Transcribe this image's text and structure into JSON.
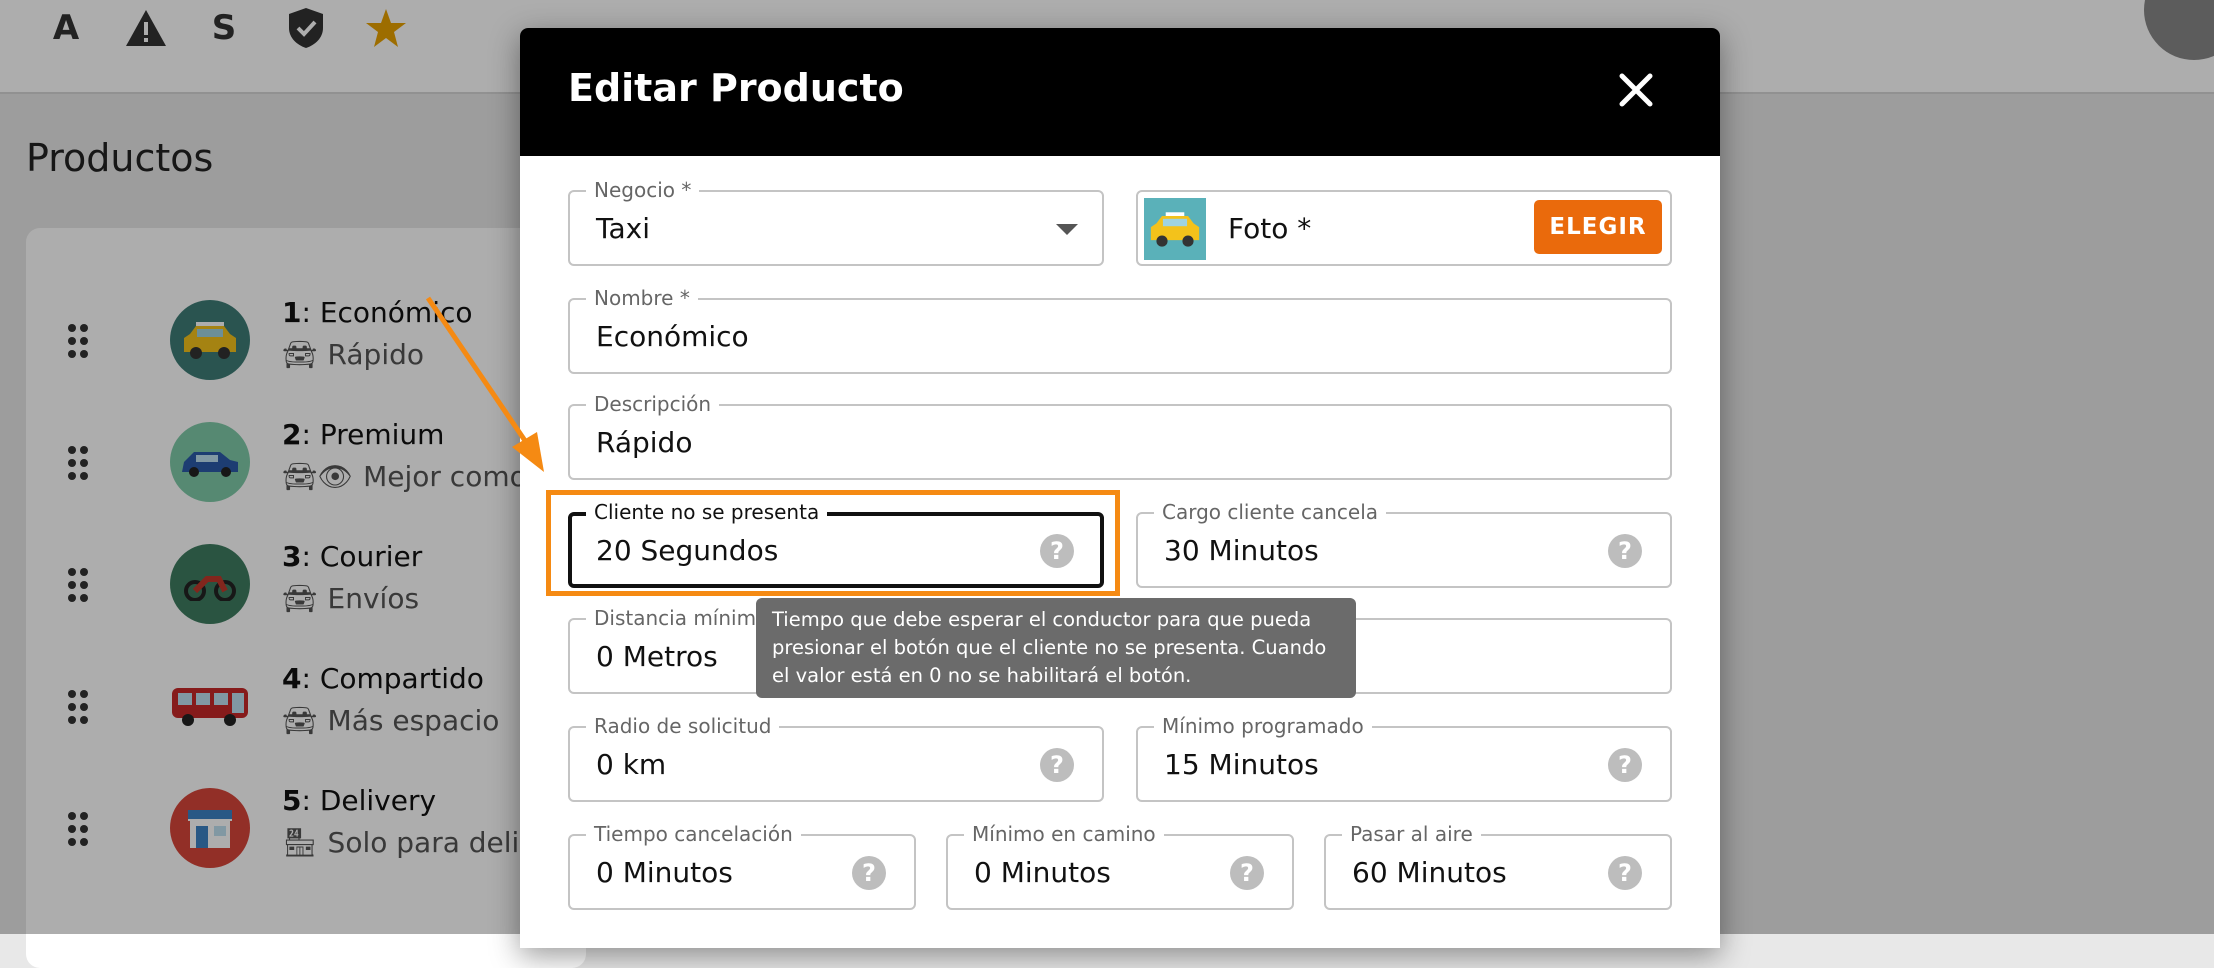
{
  "topbar": {
    "icons": [
      {
        "name": "a-icon",
        "glyph": "A"
      },
      {
        "name": "warning-icon",
        "glyph": "⚠"
      },
      {
        "name": "s-icon",
        "glyph": "S"
      },
      {
        "name": "shield-check-icon",
        "glyph": "✓"
      },
      {
        "name": "star-icon",
        "glyph": "★"
      }
    ]
  },
  "page": {
    "title": "Productos"
  },
  "products": [
    {
      "index": "1",
      "name": "Económico",
      "sub": "Rápido",
      "color": "#3f7d77",
      "icon": "taxi-icon"
    },
    {
      "index": "2",
      "name": "Premium",
      "sub": "Mejor comodi",
      "color": "#7fcaa8",
      "icon": "car-icon"
    },
    {
      "index": "3",
      "name": "Courier",
      "sub": "Envíos",
      "color": "#3f7d60",
      "icon": "motorcycle-icon"
    },
    {
      "index": "4",
      "name": "Compartido",
      "sub": "Más espacio",
      "color": "#ffffff",
      "icon": "bus-icon"
    },
    {
      "index": "5",
      "name": "Delivery",
      "sub": "Solo para delive",
      "color": "#d7463a",
      "icon": "store-icon"
    }
  ],
  "dialog": {
    "title": "Editar Producto",
    "negocio": {
      "label": "Negocio *",
      "value": "Taxi"
    },
    "foto": {
      "label": "Foto *",
      "button": "ELEGIR"
    },
    "nombre": {
      "label": "Nombre *",
      "value": "Económico"
    },
    "descripcion": {
      "label": "Descripción",
      "value": "Rápido"
    },
    "cliente_no_presenta": {
      "label": "Cliente no se presenta",
      "value": "20 Segundos"
    },
    "cargo_cliente_cancela": {
      "label": "Cargo cliente cancela",
      "value": "30 Minutos"
    },
    "distancia_minima": {
      "label": "Distancia mínima",
      "value": "0 Metros"
    },
    "radio_solicitud": {
      "label": "Radio de solicitud",
      "value": "0 km"
    },
    "minimo_programado": {
      "label": "Mínimo programado",
      "value": "15 Minutos"
    },
    "tiempo_cancelacion": {
      "label": "Tiempo cancelación",
      "value": "0 Minutos"
    },
    "minimo_en_camino": {
      "label": "Mínimo en camino",
      "value": "0 Minutos"
    },
    "pasar_al_aire": {
      "label": "Pasar al aire",
      "value": "60 Minutos"
    },
    "help_glyph": "?"
  },
  "tooltip": {
    "text": "Tiempo que debe esperar el conductor para que pueda presionar el botón que el cliente no se presenta. Cuando el valor está en 0 no se habilitará el botón."
  },
  "colors": {
    "accent": "#ea6a0c",
    "highlight": "#f58a13",
    "dialog_header": "#000000"
  }
}
